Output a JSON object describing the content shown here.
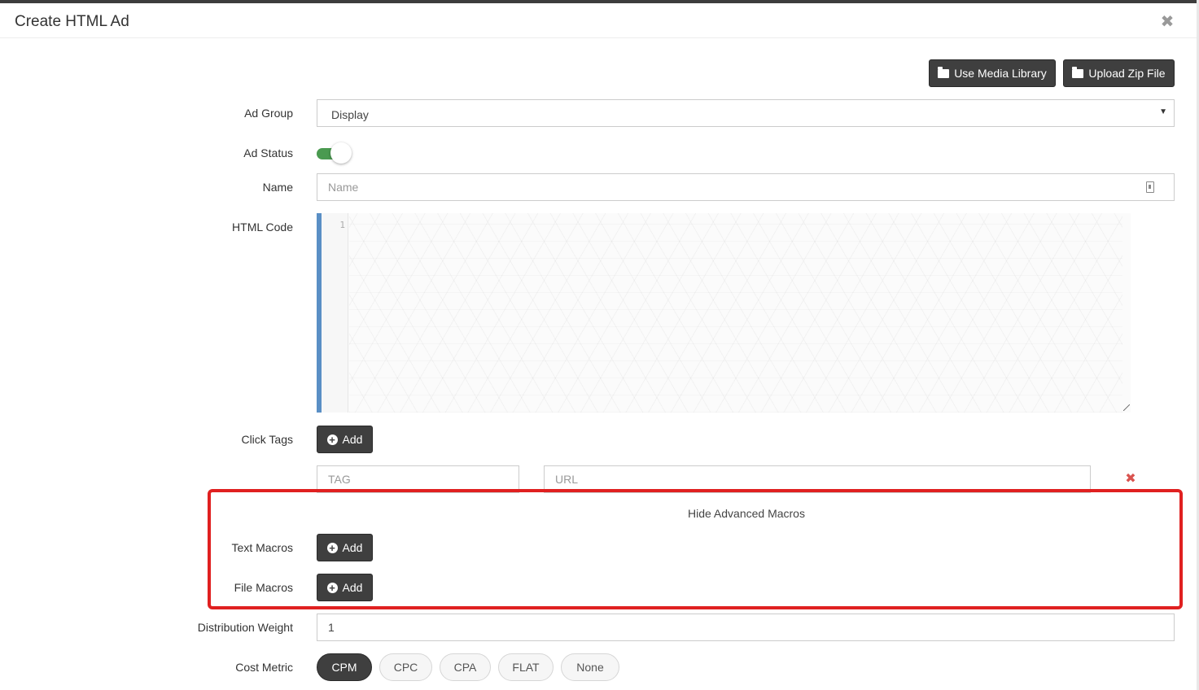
{
  "dialog": {
    "title": "Create HTML Ad",
    "close_glyph": "✖"
  },
  "toolbar": {
    "media_library_label": "Use Media Library",
    "upload_zip_label": "Upload Zip File"
  },
  "form": {
    "ad_group": {
      "label": "Ad Group",
      "value": "Display"
    },
    "ad_status": {
      "label": "Ad Status",
      "on": true
    },
    "name": {
      "label": "Name",
      "placeholder": "Name",
      "value": ""
    },
    "html_code": {
      "label": "HTML Code",
      "line_number": "1",
      "value": ""
    },
    "click_tags": {
      "label": "Click Tags",
      "add_label": "Add",
      "tag_placeholder": "TAG",
      "url_placeholder": "URL",
      "remove_glyph": "✖"
    },
    "advanced": {
      "toggle_label": "Hide Advanced Macros",
      "text_macros": {
        "label": "Text Macros",
        "add_label": "Add"
      },
      "file_macros": {
        "label": "File Macros",
        "add_label": "Add"
      }
    },
    "distribution_weight": {
      "label": "Distribution Weight",
      "value": "1"
    },
    "cost_metric": {
      "label": "Cost Metric",
      "options": [
        "CPM",
        "CPC",
        "CPA",
        "FLAT",
        "None"
      ],
      "selected": "CPM"
    }
  },
  "colors": {
    "dark_button": "#3f3f3f",
    "toggle_on": "#4a9a50",
    "editor_accent": "#5a8fc5",
    "highlight": "#e02020",
    "remove": "#d9534f"
  },
  "icons": [
    "close-icon",
    "folder-icon",
    "plus-circle-icon",
    "dropdown-caret-icon",
    "contact-card-icon",
    "remove-icon",
    "resize-handle-icon"
  ]
}
